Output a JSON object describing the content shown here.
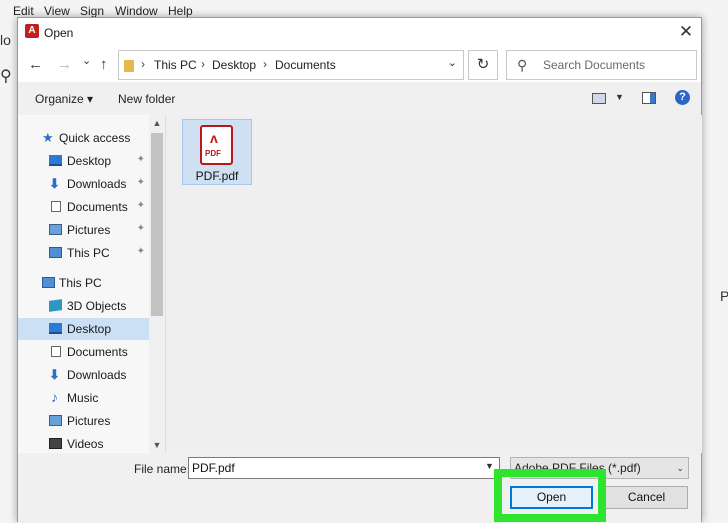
{
  "app": {
    "menu": [
      "Edit",
      "View",
      "Sign",
      "Window",
      "Help"
    ],
    "bg_left_fragment": "lo",
    "bg_right_fragment": "P"
  },
  "dialog": {
    "title": "Open",
    "title_icon": "acrobat-icon",
    "close_symbol": "✕"
  },
  "nav": {
    "back_symbol": "←",
    "forward_symbol": "→",
    "recent_symbol": "⌄",
    "up_symbol": "↑",
    "breadcrumbs": [
      "This PC",
      "Desktop",
      "Documents"
    ],
    "separator": "›",
    "refresh_symbol": "↻",
    "search_placeholder": "Search Documents"
  },
  "toolbar": {
    "organize_label": "Organize ▾",
    "new_folder_label": "New folder",
    "help_symbol": "?"
  },
  "sidebar": {
    "items": [
      {
        "label": "Quick access",
        "icon": "star-icon",
        "pinned": false
      },
      {
        "label": "Desktop",
        "icon": "desktop-icon",
        "pinned": true
      },
      {
        "label": "Downloads",
        "icon": "downloads-icon",
        "pinned": true
      },
      {
        "label": "Documents",
        "icon": "documents-icon",
        "pinned": true
      },
      {
        "label": "Pictures",
        "icon": "pictures-icon",
        "pinned": true
      },
      {
        "label": "This PC",
        "icon": "pc-icon",
        "pinned": true
      },
      {
        "label": "This PC",
        "icon": "pc-icon",
        "pinned": false
      },
      {
        "label": "3D Objects",
        "icon": "3d-objects-icon",
        "pinned": false
      },
      {
        "label": "Desktop",
        "icon": "desktop-icon",
        "pinned": false,
        "selected": true
      },
      {
        "label": "Documents",
        "icon": "documents-icon",
        "pinned": false
      },
      {
        "label": "Downloads",
        "icon": "downloads-icon",
        "pinned": false
      },
      {
        "label": "Music",
        "icon": "music-icon",
        "pinned": false
      },
      {
        "label": "Pictures",
        "icon": "pictures-icon",
        "pinned": false
      },
      {
        "label": "Videos",
        "icon": "videos-icon",
        "pinned": false
      }
    ],
    "pin_symbol": "📌"
  },
  "files": [
    {
      "name": "PDF.pdf",
      "icon": "pdf-file-icon",
      "badge": "PDF",
      "selected": true
    }
  ],
  "footer": {
    "file_name_label": "File name:",
    "file_name_value": "PDF.pdf",
    "file_type": "Adobe PDF Files (*.pdf)",
    "open_label": "Open",
    "cancel_label": "Cancel"
  },
  "colors": {
    "highlight": "#2ee42e",
    "accent": "#0078d7",
    "pdf_red": "#c41e1e"
  }
}
